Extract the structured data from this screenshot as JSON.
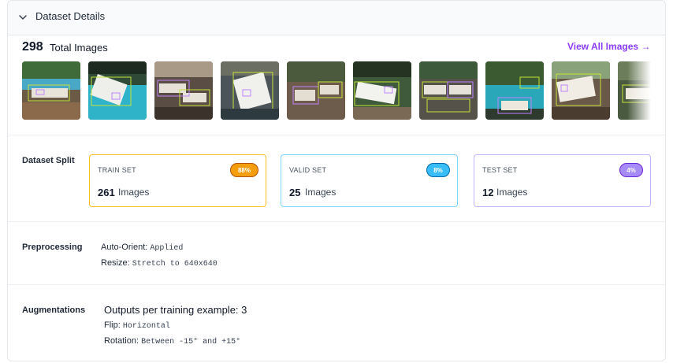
{
  "header": {
    "title": "Dataset Details"
  },
  "summary": {
    "count": "298",
    "label": "Total Images",
    "view_all": "View All Images →"
  },
  "thumbnails": [
    {
      "name": "thumb-1"
    },
    {
      "name": "thumb-2"
    },
    {
      "name": "thumb-3"
    },
    {
      "name": "thumb-4"
    },
    {
      "name": "thumb-5"
    },
    {
      "name": "thumb-6"
    },
    {
      "name": "thumb-7"
    },
    {
      "name": "thumb-8"
    },
    {
      "name": "thumb-9"
    },
    {
      "name": "thumb-10"
    }
  ],
  "split": {
    "label": "Dataset Split",
    "train": {
      "name": "TRAIN SET",
      "pct": "88%",
      "count": "261",
      "unit": "Images",
      "color": "#f59e0b"
    },
    "valid": {
      "name": "VALID SET",
      "pct": "8%",
      "count": "25",
      "unit": "Images",
      "color": "#38bdf8"
    },
    "test": {
      "name": "TEST SET",
      "pct": "4%",
      "count": "12",
      "unit": "Images",
      "color": "#a78bfa"
    }
  },
  "preprocessing": {
    "label": "Preprocessing",
    "auto_orient_key": "Auto-Orient:",
    "auto_orient_val": "Applied",
    "resize_key": "Resize:",
    "resize_val": "Stretch to 640x640"
  },
  "augmentations": {
    "label": "Augmentations",
    "outputs": "Outputs per training example: 3",
    "flip_key": "Flip:",
    "flip_val": "Horizontal",
    "rotation_key": "Rotation:",
    "rotation_val": "Between -15° and +15°"
  },
  "colors": {
    "accent": "#8b3cf7",
    "border": "#e5e7eb"
  }
}
